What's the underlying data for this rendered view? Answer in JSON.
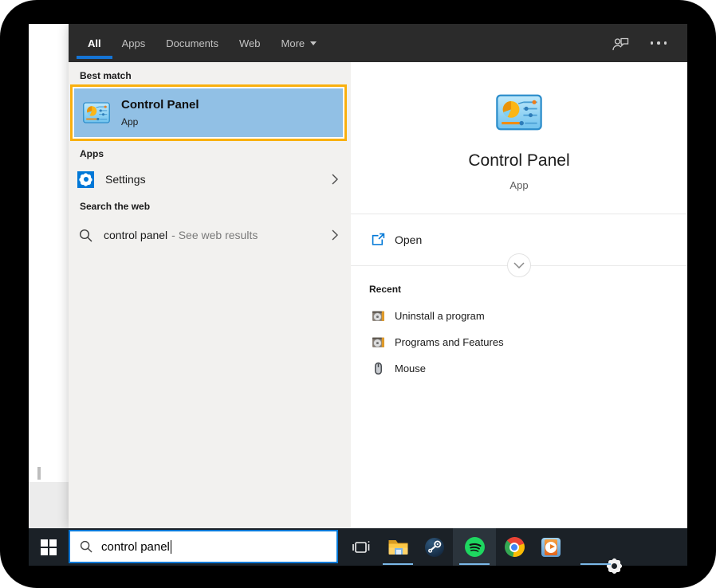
{
  "colors": {
    "accent_blue": "#0078d7",
    "tab_underline_blue": "#1574d4",
    "best_match_highlight_blue": "#91c0e5",
    "annotation_orange": "#f9b00e",
    "topbar_bg": "#2b2b2b",
    "taskbar_bg": "#1b2127",
    "taskbar_open_underline": "#7ab8e8",
    "left_pane_bg": "#f2f1ef"
  },
  "search_flyout": {
    "tabs": [
      {
        "label": "All",
        "active": true
      },
      {
        "label": "Apps",
        "active": false
      },
      {
        "label": "Documents",
        "active": false
      },
      {
        "label": "Web",
        "active": false
      },
      {
        "label": "More",
        "active": false,
        "has_dropdown": true
      }
    ],
    "header_icons": [
      "feedback-user-icon",
      "ellipsis-icon"
    ],
    "best_match": {
      "header": "Best match",
      "title": "Control Panel",
      "subtitle": "App",
      "icon": "control-panel-icon",
      "annotated": true
    },
    "apps": {
      "header": "Apps",
      "items": [
        {
          "label": "Settings",
          "icon": "settings-gear-icon",
          "expandable": true
        }
      ]
    },
    "web": {
      "header": "Search the web",
      "query": "control panel",
      "suffix": "- See web results",
      "icon": "search-icon",
      "expandable": true
    },
    "preview": {
      "icon": "control-panel-icon",
      "title": "Control Panel",
      "subtitle": "App",
      "open_label": "Open",
      "recent_header": "Recent",
      "recent": [
        {
          "label": "Uninstall a program",
          "icon": "programs-icon"
        },
        {
          "label": "Programs and Features",
          "icon": "programs-icon"
        },
        {
          "label": "Mouse",
          "icon": "mouse-icon"
        }
      ]
    }
  },
  "taskbar": {
    "search_value": "control panel",
    "icons": [
      "start",
      "task-view",
      "file-explorer",
      "steam",
      "spotify",
      "chrome",
      "media-player",
      "settings"
    ],
    "apps_with_open_indicator": [
      "file-explorer",
      "spotify",
      "settings"
    ],
    "active_app": "spotify"
  }
}
